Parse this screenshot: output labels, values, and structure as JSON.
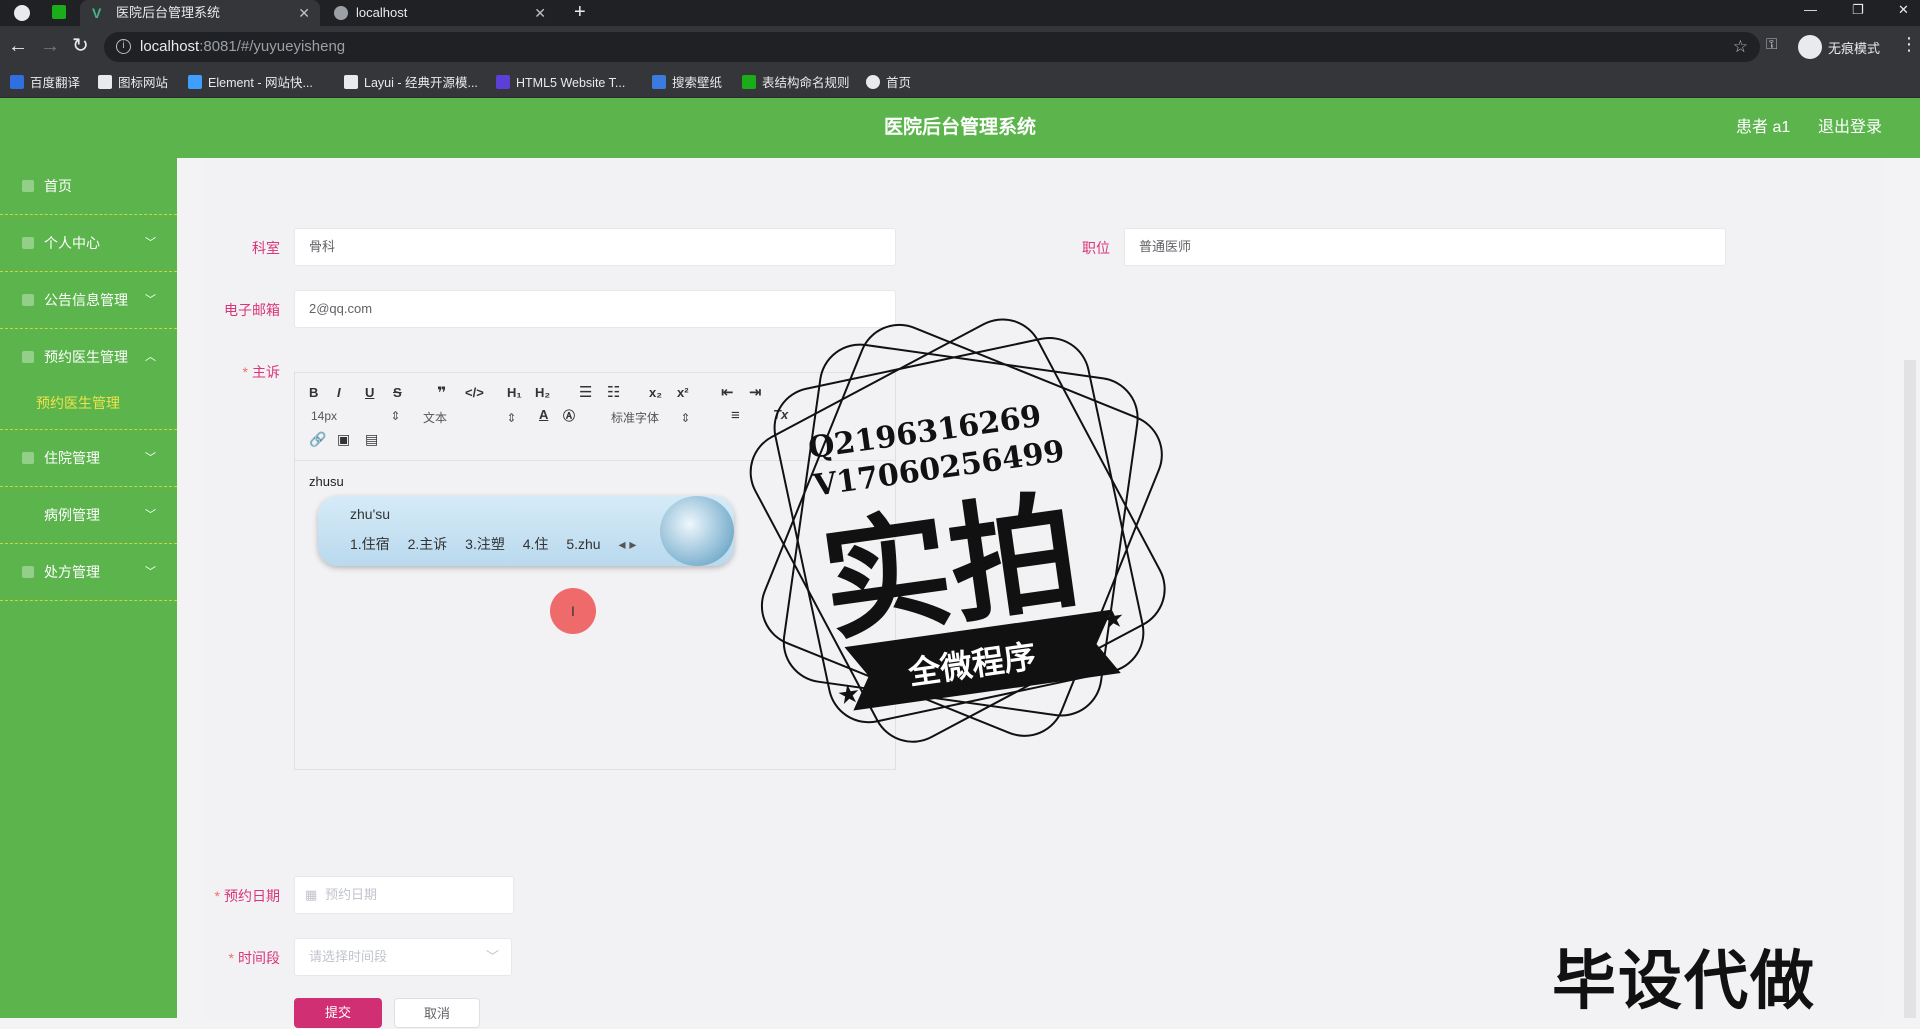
{
  "browser": {
    "tabs": [
      {
        "title": "医院后台管理系统",
        "active": true
      },
      {
        "title": "localhost",
        "active": false
      }
    ],
    "url_host": "localhost",
    "url_rest": ":8081/#/yuyueyisheng",
    "incognito_label": "无痕模式",
    "bookmarks": [
      {
        "label": "百度翻译",
        "color": "#2f6fe0"
      },
      {
        "label": "图标网站",
        "color": "#e8eaed"
      },
      {
        "label": "Element - 网站快...",
        "color": "#409eff"
      },
      {
        "label": "Layui - 经典开源模...",
        "color": "#e8eaed"
      },
      {
        "label": "HTML5 Website T...",
        "color": "#5b3fd6"
      },
      {
        "label": "搜索壁纸",
        "color": "#3b7be0"
      },
      {
        "label": "表结构命名规则",
        "color": "#1aad19"
      },
      {
        "label": "首页",
        "color": "#e8eaed"
      }
    ]
  },
  "header": {
    "title": "医院后台管理系统",
    "user": "患者 a1",
    "logout": "退出登录"
  },
  "sidebar": {
    "items": [
      {
        "label": "首页"
      },
      {
        "label": "个人中心"
      },
      {
        "label": "公告信息管理"
      },
      {
        "label": "预约医生管理"
      },
      {
        "label": "住院管理"
      },
      {
        "label": "病例管理"
      },
      {
        "label": "处方管理"
      }
    ],
    "submenu_active": "预约医生管理"
  },
  "form": {
    "department_label": "科室",
    "department_value": "骨科",
    "position_label": "职位",
    "position_value": "普通医师",
    "email_label": "电子邮箱",
    "email_value": "2@qq.com",
    "complaint_label": "主诉",
    "editor_text": "zhusu",
    "font_size": "14px",
    "block_type": "文本",
    "font_family": "标准字体",
    "date_label": "预约日期",
    "date_placeholder": "预约日期",
    "timeslot_label": "时间段",
    "timeslot_placeholder": "请选择时间段",
    "submit_label": "提交",
    "cancel_label": "取消"
  },
  "ime": {
    "composition": "zhu'su",
    "candidates": [
      "1.住宿",
      "2.主诉",
      "3.注塑",
      "4.住",
      "5.zhu"
    ]
  },
  "watermark": {
    "qq": "Q2196316269",
    "vx": "V17060256499",
    "big": "实拍",
    "ribbon": "全微程序",
    "bottom": "毕设代做"
  },
  "colors": {
    "brand_green": "#5bb54c",
    "label_pink": "#d9367a",
    "submit_magenta": "#d12f73",
    "submenu_yellow": "#f0e24a"
  }
}
